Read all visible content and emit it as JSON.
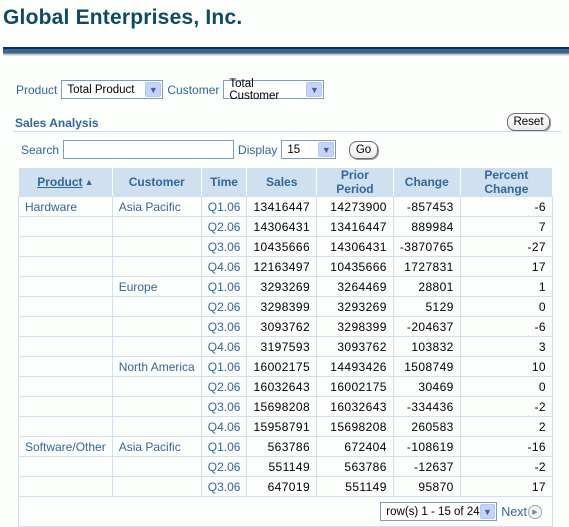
{
  "header": {
    "title": "Global Enterprises, Inc."
  },
  "filters": {
    "product_label": "Product",
    "product_value": "Total Product",
    "customer_label": "Customer",
    "customer_value": "Total Customer"
  },
  "section": {
    "title": "Sales Analysis",
    "reset_label": "Reset"
  },
  "search": {
    "label": "Search",
    "value": "",
    "placeholder": "",
    "display_label": "Display",
    "display_value": "15",
    "go_label": "Go"
  },
  "table": {
    "columns": [
      "Product",
      "Customer",
      "Time",
      "Sales",
      "Prior Period",
      "Change",
      "Percent Change"
    ],
    "sort_icon": "sort-ascending-icon",
    "rows": [
      {
        "product": "Hardware",
        "customer": "Asia Pacific",
        "time": "Q1.06",
        "sales": "13416447",
        "prior": "14273900",
        "change": "-857453",
        "pct": "-6"
      },
      {
        "product": "",
        "customer": "",
        "time": "Q2.06",
        "sales": "14306431",
        "prior": "13416447",
        "change": "889984",
        "pct": "7"
      },
      {
        "product": "",
        "customer": "",
        "time": "Q3.06",
        "sales": "10435666",
        "prior": "14306431",
        "change": "-3870765",
        "pct": "-27"
      },
      {
        "product": "",
        "customer": "",
        "time": "Q4.06",
        "sales": "12163497",
        "prior": "10435666",
        "change": "1727831",
        "pct": "17"
      },
      {
        "product": "",
        "customer": "Europe",
        "time": "Q1.06",
        "sales": "3293269",
        "prior": "3264469",
        "change": "28801",
        "pct": "1"
      },
      {
        "product": "",
        "customer": "",
        "time": "Q2.06",
        "sales": "3298399",
        "prior": "3293269",
        "change": "5129",
        "pct": "0"
      },
      {
        "product": "",
        "customer": "",
        "time": "Q3.06",
        "sales": "3093762",
        "prior": "3298399",
        "change": "-204637",
        "pct": "-6"
      },
      {
        "product": "",
        "customer": "",
        "time": "Q4.06",
        "sales": "3197593",
        "prior": "3093762",
        "change": "103832",
        "pct": "3"
      },
      {
        "product": "",
        "customer": "North America",
        "time": "Q1.06",
        "sales": "16002175",
        "prior": "14493426",
        "change": "1508749",
        "pct": "10"
      },
      {
        "product": "",
        "customer": "",
        "time": "Q2.06",
        "sales": "16032643",
        "prior": "16002175",
        "change": "30469",
        "pct": "0"
      },
      {
        "product": "",
        "customer": "",
        "time": "Q3.06",
        "sales": "15698208",
        "prior": "16032643",
        "change": "-334436",
        "pct": "-2"
      },
      {
        "product": "",
        "customer": "",
        "time": "Q4.06",
        "sales": "15958791",
        "prior": "15698208",
        "change": "260583",
        "pct": "2"
      },
      {
        "product": "Software/Other",
        "customer": "Asia Pacific",
        "time": "Q1.06",
        "sales": "563786",
        "prior": "672404",
        "change": "-108619",
        "pct": "-16"
      },
      {
        "product": "",
        "customer": "",
        "time": "Q2.06",
        "sales": "551149",
        "prior": "563786",
        "change": "-12637",
        "pct": "-2"
      },
      {
        "product": "",
        "customer": "",
        "time": "Q3.06",
        "sales": "647019",
        "prior": "551149",
        "change": "95870",
        "pct": "17"
      }
    ]
  },
  "pagination": {
    "range_value": "row(s) 1 - 15 of 24",
    "next_label": "Next"
  },
  "colors": {
    "brand": "#0f4a64",
    "accent": "#336699",
    "header_bg": "#cfe0f1"
  }
}
